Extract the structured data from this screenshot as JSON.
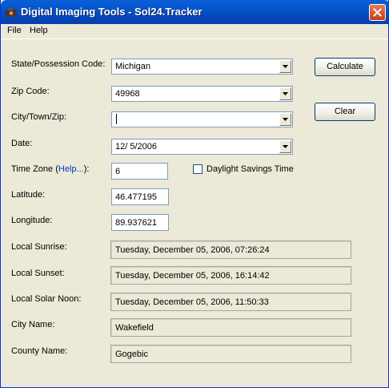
{
  "window": {
    "title": "Digital Imaging Tools - Sol24.Tracker"
  },
  "menu": {
    "items": [
      "File",
      "Help"
    ]
  },
  "form": {
    "state_label": "State/Possession Code:",
    "state_value": "Michigan",
    "zip_label": "Zip Code:",
    "zip_value": "49968",
    "city_label": "City/Town/Zip:",
    "city_value": "",
    "date_label": "Date:",
    "date_value": "12/  5/2006",
    "timezone_label": "Time Zone (",
    "timezone_help": "Help...",
    "timezone_label_end": "):",
    "timezone_value": "6",
    "dst_label": "Daylight Savings Time",
    "dst_checked": false,
    "latitude_label": "Latitude:",
    "latitude_value": "46.477195",
    "longitude_label": "Longitude:",
    "longitude_value": "89.937621",
    "sunrise_label": "Local Sunrise:",
    "sunrise_value": "Tuesday, December 05, 2006,  07:26:24",
    "sunset_label": "Local Sunset:",
    "sunset_value": "Tuesday, December 05, 2006,  16:14:42",
    "noon_label": "Local Solar Noon:",
    "noon_value": "Tuesday, December 05, 2006,  11:50:33",
    "city_name_label": "City Name:",
    "city_name_value": "Wakefield",
    "county_name_label": "County Name:",
    "county_name_value": "Gogebic"
  },
  "buttons": {
    "calculate": "Calculate",
    "clear": "Clear"
  }
}
